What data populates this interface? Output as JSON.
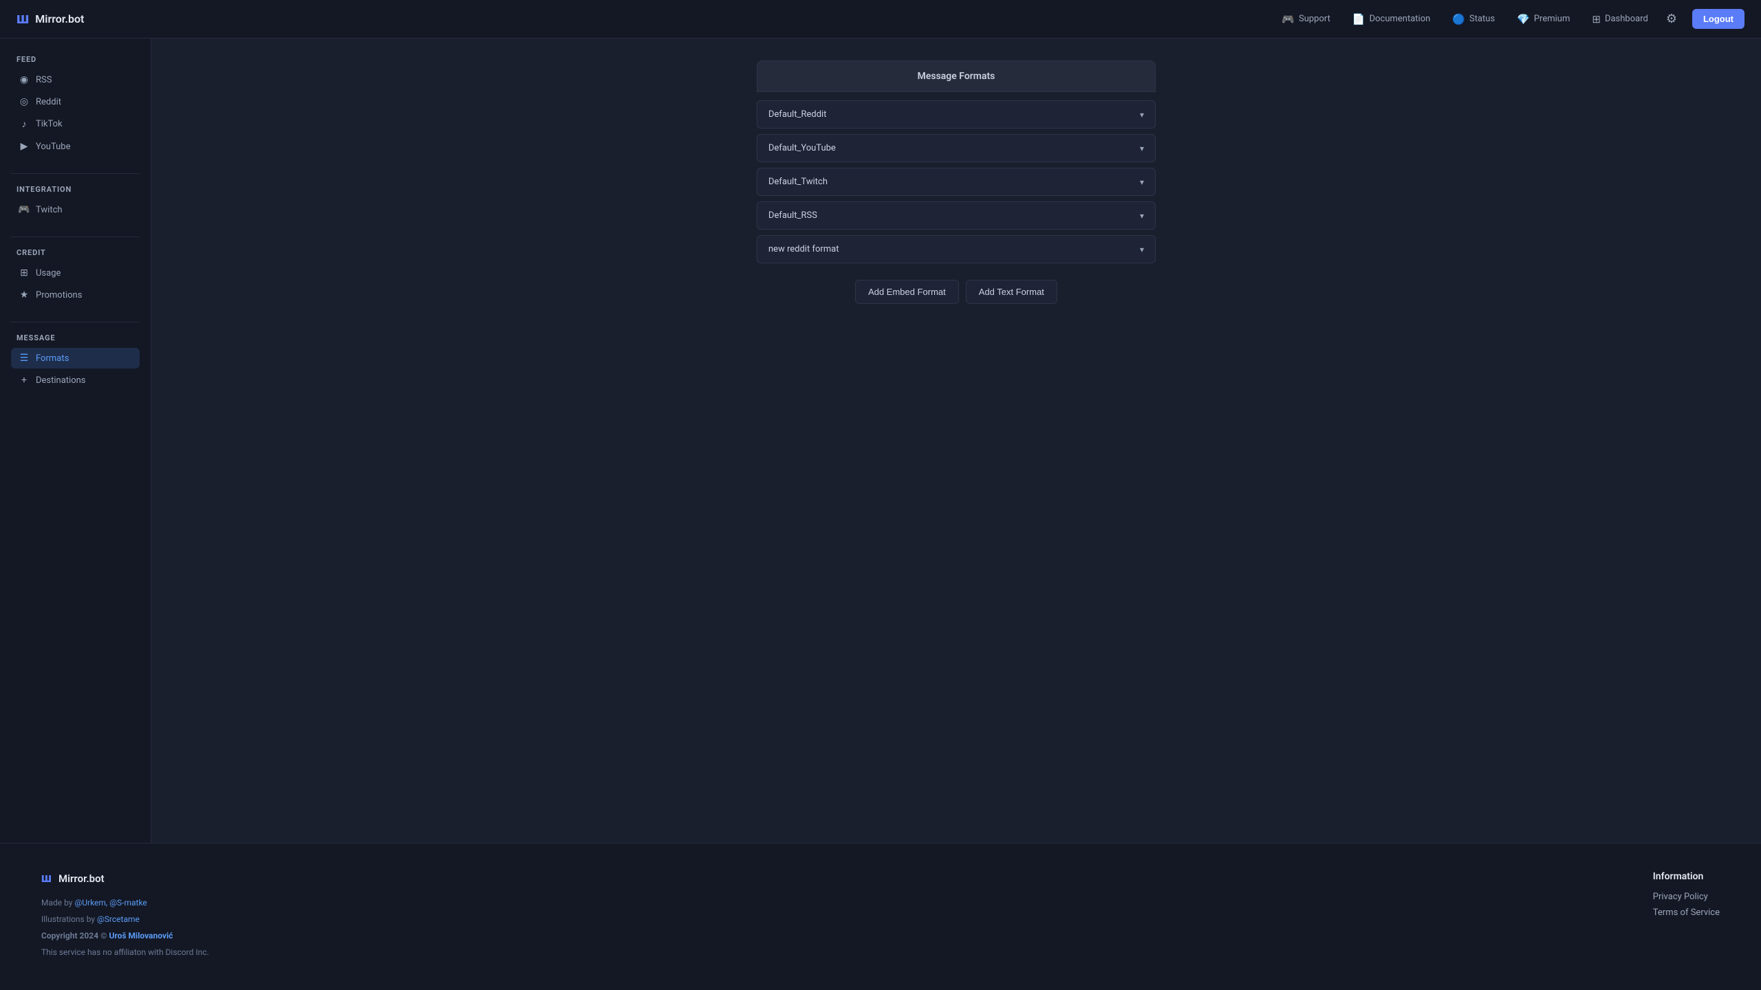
{
  "header": {
    "logo_icon": "m",
    "logo_text": "Mirror.bot",
    "nav_items": [
      {
        "id": "support",
        "label": "Support",
        "icon": "🎮"
      },
      {
        "id": "documentation",
        "label": "Documentation",
        "icon": "📄"
      },
      {
        "id": "status",
        "label": "Status",
        "icon": "🔵"
      },
      {
        "id": "premium",
        "label": "Premium",
        "icon": "💎"
      },
      {
        "id": "dashboard",
        "label": "Dashboard",
        "icon": "⊞"
      }
    ],
    "logout_label": "Logout"
  },
  "sidebar": {
    "sections": [
      {
        "id": "feed",
        "title": "Feed",
        "items": [
          {
            "id": "rss",
            "label": "RSS",
            "icon": "◉"
          },
          {
            "id": "reddit",
            "label": "Reddit",
            "icon": "◎"
          },
          {
            "id": "tiktok",
            "label": "TikTok",
            "icon": "♪"
          },
          {
            "id": "youtube",
            "label": "YouTube",
            "icon": "▶"
          }
        ]
      },
      {
        "id": "integration",
        "title": "Integration",
        "items": [
          {
            "id": "twitch",
            "label": "Twitch",
            "icon": "🎮"
          }
        ]
      },
      {
        "id": "credit",
        "title": "Credit",
        "items": [
          {
            "id": "usage",
            "label": "Usage",
            "icon": "⊞"
          },
          {
            "id": "promotions",
            "label": "Promotions",
            "icon": "★"
          }
        ]
      },
      {
        "id": "message",
        "title": "Message",
        "items": [
          {
            "id": "formats",
            "label": "Formats",
            "icon": "☰",
            "active": true
          },
          {
            "id": "destinations",
            "label": "Destinations",
            "icon": "+"
          }
        ]
      }
    ]
  },
  "main": {
    "panel_title": "Message Formats",
    "formats": [
      {
        "id": "default-reddit",
        "label": "Default_Reddit"
      },
      {
        "id": "default-youtube",
        "label": "Default_YouTube"
      },
      {
        "id": "default-twitch",
        "label": "Default_Twitch"
      },
      {
        "id": "default-rss",
        "label": "Default_RSS"
      },
      {
        "id": "new-reddit-format",
        "label": "new reddit format"
      }
    ],
    "add_embed_label": "Add Embed Format",
    "add_text_label": "Add Text Format"
  },
  "footer": {
    "logo_icon": "m",
    "logo_text": "Mirror.bot",
    "made_by_prefix": "Made by ",
    "made_by_users": "@Urkem, @S-matke",
    "illustrations_prefix": "Illustrations by ",
    "illustrations_user": "@Srcetame",
    "copyright": "Copyright 2024 © ",
    "copyright_owner": "Uroš Milovanović",
    "disclaimer": "This service has no affiliaton with Discord Inc.",
    "info_title": "Information",
    "info_links": [
      {
        "id": "privacy",
        "label": "Privacy Policy"
      },
      {
        "id": "terms",
        "label": "Terms of Service"
      }
    ]
  }
}
